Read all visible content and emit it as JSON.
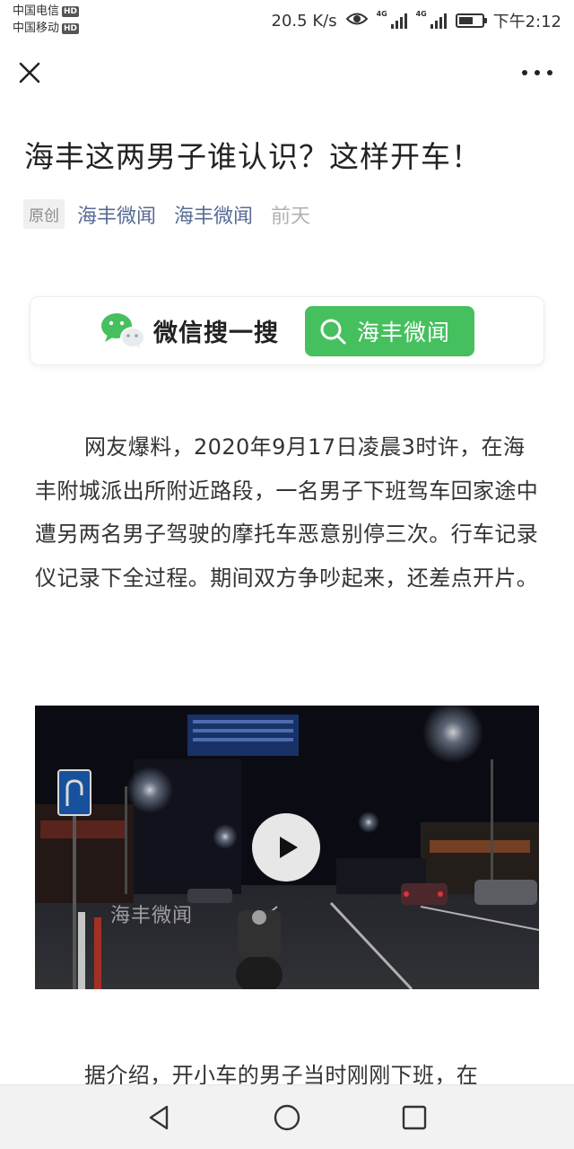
{
  "status_bar": {
    "carrier1": "中国电信",
    "carrier2": "中国移动",
    "hd_badge": "HD",
    "net_speed": "20.5 K/s",
    "signal_tag": "4G",
    "time": "下午2:12",
    "battery_level_percent": 65
  },
  "article": {
    "title": "海丰这两男子谁认识？这样开车！",
    "original_tag": "原创",
    "author1": "海丰微闻",
    "author2": "海丰微闻",
    "date": "前天",
    "paragraph1": "网友爆料，2020年9月17日凌晨3时许，在海丰附城派出所附近路段，一名男子下班驾车回家途中遭另两名男子驾驶的摩托车恶意别停三次。行车记录仪记录下全过程。期间双方争吵起来，还差点开片。",
    "paragraph2": "据介绍，开小车的男子当时刚刚下班，在"
  },
  "search_card": {
    "label": "微信搜一搜",
    "button_text": "海丰微闻"
  },
  "video": {
    "watermark": "海丰微闻"
  },
  "icons": {
    "close": "close-icon",
    "more": "more-icon",
    "wechat": "wechat-logo",
    "search": "search-icon",
    "play": "play-icon",
    "back": "back-triangle-icon",
    "home": "home-circle-icon",
    "recents": "recents-square-icon",
    "eye": "eye-icon",
    "battery": "battery-icon"
  },
  "colors": {
    "link": "#576b95",
    "accent_green": "#46c05e",
    "muted": "#b2b2b2"
  }
}
